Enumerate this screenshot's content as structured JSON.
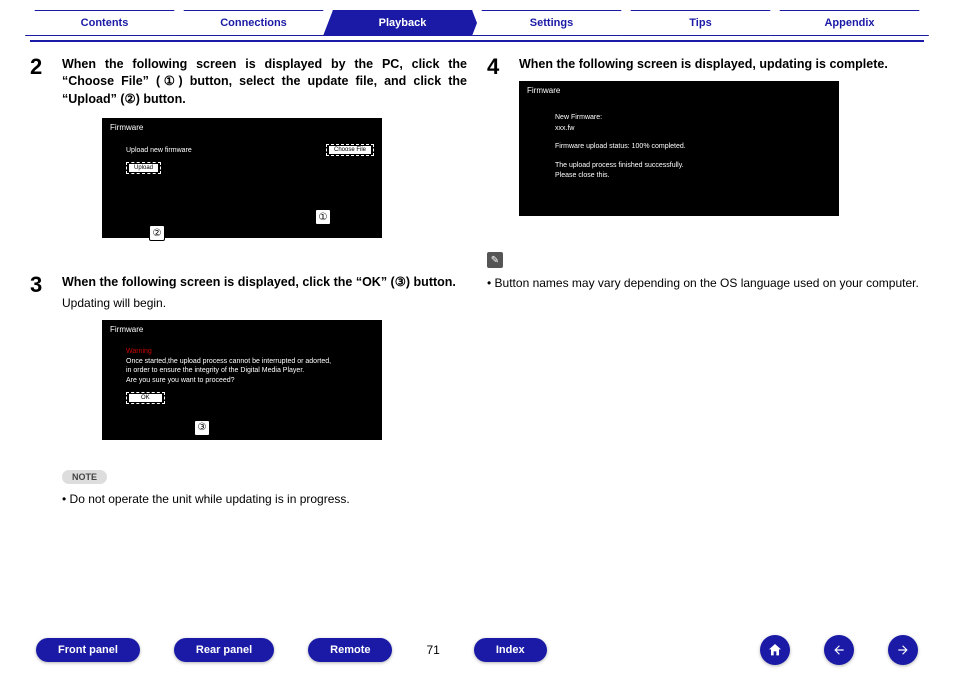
{
  "tabs": {
    "contents": "Contents",
    "connections": "Connections",
    "playback": "Playback",
    "settings": "Settings",
    "tips": "Tips",
    "appendix": "Appendix"
  },
  "step2": {
    "num": "2",
    "title": "When the following screen is displayed by the PC, click the “Choose File” (①) button, select the update file, and click the “Upload” (②) button.",
    "fw_title": "Firmware",
    "upload_label": "Upload new firmware",
    "upload_btn": "Upload",
    "choose_btn": "Choose File",
    "marker1": "①",
    "marker2": "②"
  },
  "step3": {
    "num": "3",
    "title": "When the following screen is displayed, click the “OK” (③) button.",
    "sub": "Updating will begin.",
    "fw_title": "Firmware",
    "warning": "Warning",
    "warn_l1": "Once started,the upload process cannot be interrupted or adorted,",
    "warn_l2": "in order to ensure the integrity of the Digital Media Player.",
    "warn_l3": "Are you sure you want to proceed?",
    "ok_btn": "OK",
    "marker3": "③"
  },
  "step4": {
    "num": "4",
    "title": "When the following screen is displayed, updating is complete.",
    "fw_title": "Firmware",
    "l1": "New Firmware:",
    "l2": "xxx.fw",
    "l3": "Firmware upload status: 100% completed.",
    "l4": "The upload process finished successfully.",
    "l5": "Please close this."
  },
  "note": {
    "label": "NOTE",
    "text": "Do not operate the unit while updating is in progress."
  },
  "tip": {
    "icon": "✎",
    "text": "Button names may vary depending on the OS language used on your computer."
  },
  "bottom": {
    "front": "Front panel",
    "rear": "Rear panel",
    "remote": "Remote",
    "page": "71",
    "index": "Index"
  },
  "bullet": "• "
}
